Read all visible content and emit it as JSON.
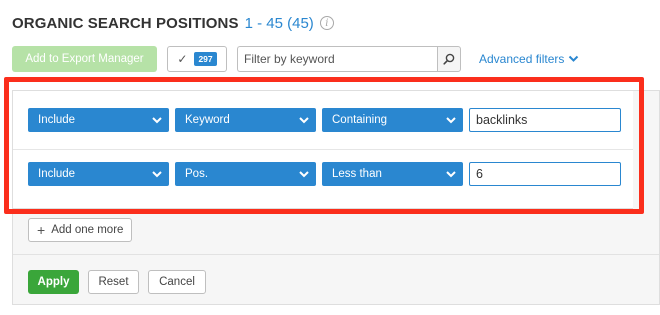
{
  "header": {
    "title": "ORGANIC SEARCH POSITIONS",
    "range": "1 - 45 (45)",
    "info_icon": "info-icon"
  },
  "toolbar": {
    "export_label": "Add to Export Manager",
    "selected_count": "297",
    "keyword_placeholder": "Filter by keyword",
    "advanced_filters_label": "Advanced filters"
  },
  "filters": {
    "rows": [
      {
        "mode": "Include",
        "field": "Keyword",
        "operator": "Containing",
        "value": "backlinks"
      },
      {
        "mode": "Include",
        "field": "Pos.",
        "operator": "Less than",
        "value": "6"
      }
    ],
    "add_more_label": "Add one more"
  },
  "actions": {
    "apply_label": "Apply",
    "reset_label": "Reset",
    "cancel_label": "Cancel"
  },
  "colors": {
    "accent": "#2a87d0",
    "apply_green": "#3aa63a",
    "export_disabled_green": "#b6e2a7",
    "highlight_red": "#fb2e1c"
  }
}
